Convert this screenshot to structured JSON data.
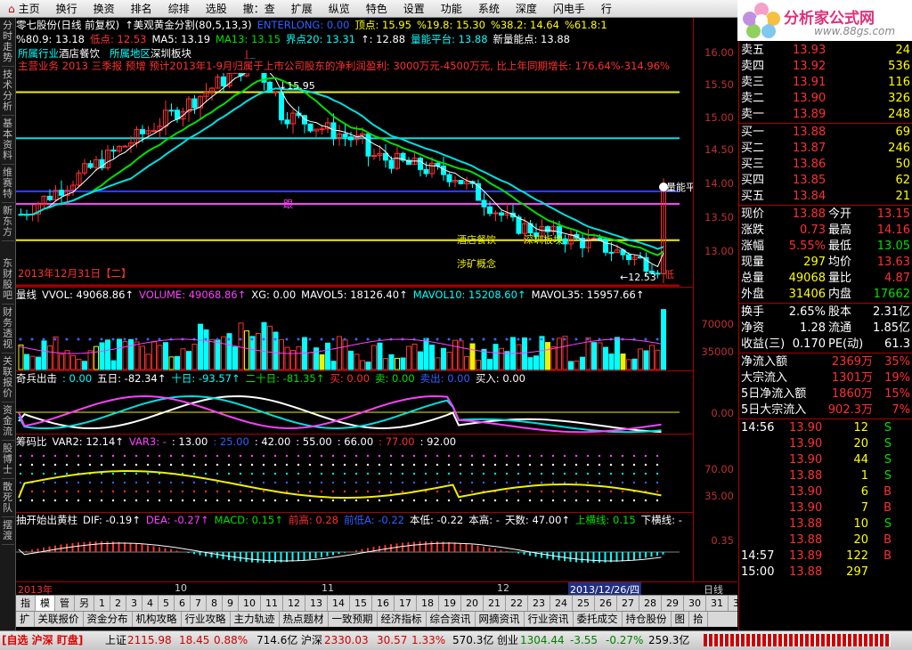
{
  "menu": [
    "主页",
    "换行",
    "换资",
    "排名",
    "综排",
    "选股",
    "撤：查",
    "扩展",
    "纵览",
    "特色",
    "设置",
    "功能",
    "系统",
    "深度",
    "闪电手",
    "行"
  ],
  "menu_first_icon": "home-icon",
  "logo": {
    "title": "分析家公式网",
    "url": "www.88gs.com"
  },
  "sidebar": [
    "分时走势",
    "技术分析",
    "基本资料",
    "维赛特",
    "新东方"
  ],
  "sidebar_lower": [
    "东财股吧",
    "财务透视",
    "关联报价",
    "资金流",
    "股博士",
    "散死队",
    "摆渡"
  ],
  "main": {
    "header_line1": [
      {
        "t": "零七股份(日线 前复权)",
        "c": "wht"
      },
      {
        "t": "↑美观黄金分割(80,5,13,3)",
        "c": "wht"
      },
      {
        "t": "ENTERLONG: 0.00",
        "c": "blu"
      },
      {
        "t": "顶点: 15.95",
        "c": "yel"
      },
      {
        "t": "%19.8: 15.30",
        "c": "yel"
      },
      {
        "t": "%38.2: 14.64",
        "c": "yel"
      },
      {
        "t": "%61.8:1",
        "c": "yel"
      }
    ],
    "header_line2": [
      {
        "t": "%80.9: 13.18",
        "c": "wht"
      },
      {
        "t": "低点: 12.53",
        "c": "red"
      },
      {
        "t": "MA5: 13.19",
        "c": "wht"
      },
      {
        "t": "MA13: 13.15",
        "c": "grn"
      },
      {
        "t": "界点20: 13.31",
        "c": "cyn"
      },
      {
        "t": "↑: 12.88",
        "c": "wht"
      },
      {
        "t": "量能平台: 13.88",
        "c": "cyn"
      },
      {
        "t": "新量能点: 13.88",
        "c": "wht"
      }
    ],
    "news": "主营业务 2013 三季报 预增 预计2013年1-9月归属于上市公司股东的净利润盈利: 3000万元-4500万元, 比上年同期增长: 176.64%-314.96%",
    "labels": {
      "industry": "所属行业",
      "industry_v": "酒店餐饮",
      "region": "所属地区",
      "region_v": "深圳板块",
      "top": "15.95",
      "follow": "跟",
      "low": "12.53",
      "low_tag": "低",
      "lineeng": "量能平",
      "tag1": "酒店餐饮",
      "tag2": "深圳板块",
      "tag3": "涉矿概念",
      "date": "2013年12月31日【二】"
    },
    "yaxis": [
      "16.00",
      "15.50",
      "15.00",
      "14.50",
      "14.00",
      "13.50",
      "13.00"
    ]
  },
  "vol": {
    "header": [
      {
        "t": "量线",
        "c": "wht"
      },
      {
        "t": "VVOL: 49068.86↑",
        "c": "wht"
      },
      {
        "t": "VOLUME: 49068.86↑",
        "c": "mag"
      },
      {
        "t": "XG: 0.00",
        "c": "wht"
      },
      {
        "t": "MAVOL5: 18126.40↑",
        "c": "wht"
      },
      {
        "t": "MAVOL10: 15208.60↑",
        "c": "cyn"
      },
      {
        "t": "MAVOL35: 15957.66↑",
        "c": "wht"
      }
    ],
    "yaxis": [
      "70000",
      "35000"
    ]
  },
  "qb": {
    "header": [
      {
        "t": "奇兵出击",
        "c": "wht"
      },
      {
        "t": ": 0.00",
        "c": "cyn"
      },
      {
        "t": "五日: -82.34↑",
        "c": "wht"
      },
      {
        "t": "十日: -93.57↑",
        "c": "cyn"
      },
      {
        "t": "二十日: -81.35↑",
        "c": "grn"
      },
      {
        "t": "买: 0.00",
        "c": "red"
      },
      {
        "t": "卖: 0.00",
        "c": "grn"
      },
      {
        "t": "卖出: 0.00",
        "c": "blu"
      },
      {
        "t": "买入: 0.00",
        "c": "wht"
      }
    ],
    "yaxis": [
      "0.00"
    ]
  },
  "cm": {
    "header": [
      {
        "t": "筹码比",
        "c": "wht"
      },
      {
        "t": "VAR2: 12.14↑",
        "c": "wht"
      },
      {
        "t": "VAR3: -",
        "c": "mag"
      },
      {
        "t": ": 13.00",
        "c": "wht"
      },
      {
        "t": ": 25.00",
        "c": "blu"
      },
      {
        "t": ": 42.00",
        "c": "wht"
      },
      {
        "t": ": 55.00",
        "c": "wht"
      },
      {
        "t": ": 66.00",
        "c": "wht"
      },
      {
        "t": ": 77.00",
        "c": "red"
      },
      {
        "t": ": 92.00",
        "c": "wht"
      }
    ],
    "yaxis": [
      "70.00",
      "35.00"
    ]
  },
  "macd": {
    "header": [
      {
        "t": "抽开始出黄柱",
        "c": "wht"
      },
      {
        "t": "DIF: -0.19↑",
        "c": "wht"
      },
      {
        "t": "DEA: -0.27↑",
        "c": "mag"
      },
      {
        "t": "MACD: 0.15↑",
        "c": "grn"
      },
      {
        "t": "前高: 0.28",
        "c": "red"
      },
      {
        "t": "前低A: -0.22",
        "c": "blu"
      },
      {
        "t": "本低: -0.22",
        "c": "wht"
      },
      {
        "t": "本高: -",
        "c": "wht"
      },
      {
        "t": "天数: 47.00↑",
        "c": "wht"
      },
      {
        "t": "上横线: 0.15",
        "c": "grn"
      },
      {
        "t": "下横线: -",
        "c": "wht"
      }
    ],
    "yaxis": [
      "0.35"
    ]
  },
  "dates": {
    "d1": "2013年",
    "d2": "10",
    "d3": "11",
    "d4": "12",
    "sel": "2013/12/26/四",
    "unit": "日线"
  },
  "tabs1": [
    "指标",
    "模板",
    "管理",
    "另存为",
    "1",
    "2",
    "3",
    "4",
    "5",
    "6",
    "7",
    "8",
    "9",
    "10",
    "11",
    "12",
    "13",
    "14",
    "15",
    "16",
    "17",
    "18",
    "19",
    "20",
    "21",
    "22",
    "23",
    "24",
    "25",
    "26",
    "27",
    "28",
    "29",
    "30",
    "31",
    "32",
    "33"
  ],
  "tabs2": [
    "扩",
    "关联报价",
    "资金分布",
    "机构攻略",
    "行业攻略",
    "主力轨迹",
    "热点题材",
    "一致预期",
    "经济指标",
    "综合资讯",
    "网摘资讯",
    "行业资讯",
    "委托成交",
    "持仓股份",
    "图",
    "拾"
  ],
  "rtabs": [
    "笔",
    "价",
    "细",
    "盘",
    "势",
    "指",
    "值",
    "买"
  ],
  "orderbook": {
    "asks": [
      [
        "卖五",
        "13.93",
        "24"
      ],
      [
        "卖四",
        "13.92",
        "536"
      ],
      [
        "卖三",
        "13.91",
        "116"
      ],
      [
        "卖二",
        "13.90",
        "326"
      ],
      [
        "卖一",
        "13.89",
        "248"
      ]
    ],
    "bids": [
      [
        "买一",
        "13.88",
        "69"
      ],
      [
        "买二",
        "13.87",
        "246"
      ],
      [
        "买三",
        "13.86",
        "50"
      ],
      [
        "买四",
        "13.85",
        "62"
      ],
      [
        "买五",
        "13.84",
        "21"
      ]
    ]
  },
  "stats": [
    [
      "现价",
      "13.88",
      "今开",
      "13.15"
    ],
    [
      "涨跌",
      "0.73",
      "最高",
      "14.16"
    ],
    [
      "涨幅",
      "5.55%",
      "最低",
      "13.05"
    ],
    [
      "现量",
      "297",
      "均价",
      "13.63"
    ],
    [
      "总量",
      "49068",
      "量比",
      "4.87"
    ],
    [
      "外盘",
      "31406",
      "内盘",
      "17662"
    ]
  ],
  "stats2": [
    [
      "换手",
      "2.65%",
      "股本",
      "2.31亿"
    ],
    [
      "净资",
      "1.28",
      "流通",
      "1.85亿"
    ],
    [
      "收益(三)",
      "0.170",
      "PE(动)",
      "61.3"
    ]
  ],
  "flows": [
    [
      "净流入额",
      "2369万",
      "35%"
    ],
    [
      "大宗流入",
      "1301万",
      "19%"
    ],
    [
      "5日净流入额",
      "1860万",
      "15%"
    ],
    [
      "5日大宗流入",
      "902.3万",
      "7%"
    ]
  ],
  "ticks": [
    [
      "14:56",
      "13.90",
      "12",
      "S"
    ],
    [
      "",
      "13.90",
      "20",
      "S"
    ],
    [
      "",
      "13.90",
      "44",
      "S"
    ],
    [
      "",
      "13.88",
      "1",
      "S"
    ],
    [
      "",
      "13.90",
      "6",
      "B"
    ],
    [
      "",
      "13.90",
      "7",
      "B"
    ],
    [
      "",
      "13.88",
      "10",
      "S"
    ],
    [
      "",
      "13.88",
      "20",
      "B"
    ],
    [
      "14:57",
      "13.89",
      "122",
      "B"
    ],
    [
      "15:00",
      "13.88",
      "297",
      ""
    ]
  ],
  "status": {
    "tag": "[自选 沪深 盯盘]",
    "sh": "上证",
    "sh_v": "2115.98",
    "sh_c": "18.45",
    "sh_p": "0.88%",
    "sh_a": "714.6亿",
    "sz": "沪深",
    "sz_v": "2330.03",
    "sz_c": "30.57",
    "sz_p": "1.33%",
    "sz_a": "570.3亿",
    "cy": "创业",
    "cy_v": "1304.44",
    "cy_c": "-3.55",
    "cy_p": "-0.27%",
    "cy_a": "259.3亿"
  },
  "chart_data": {
    "type": "candlestick",
    "title": "零七股份(日线 前复权)",
    "price_range": [
      12.5,
      16.2
    ],
    "high": 15.95,
    "low": 12.53,
    "last": 13.88
  }
}
